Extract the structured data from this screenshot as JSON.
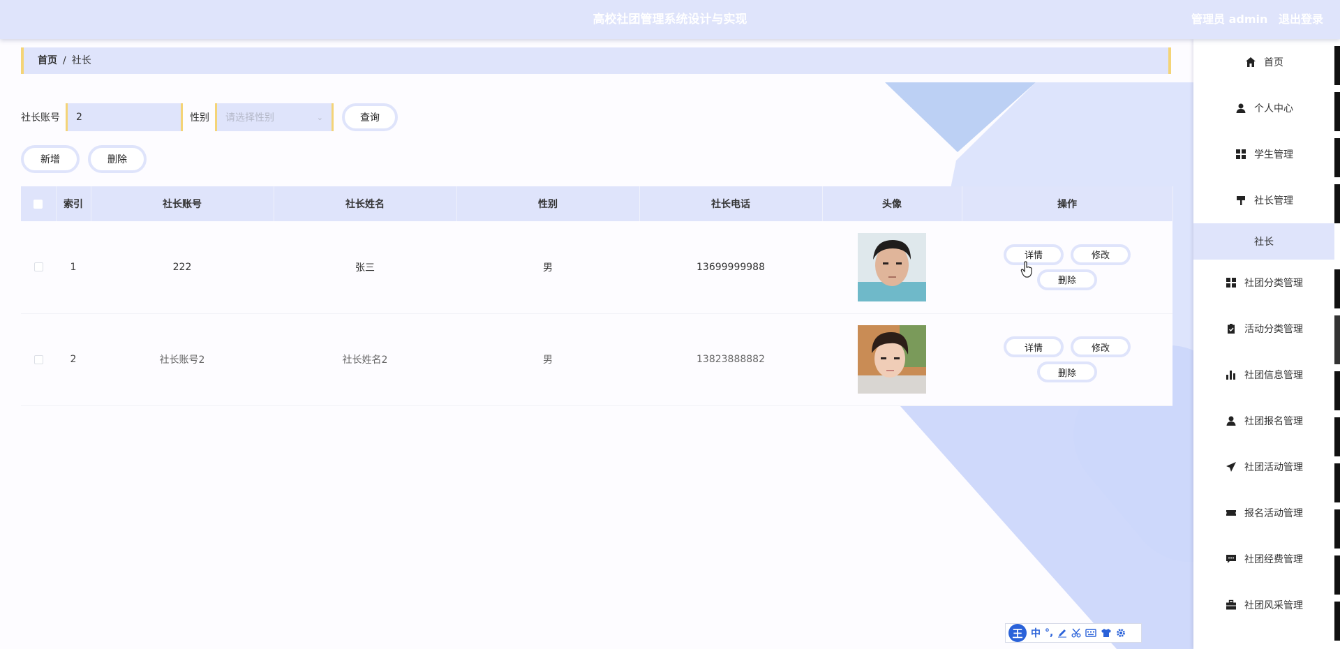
{
  "header": {
    "title": "高校社团管理系统设计与实现",
    "role": "管理员 admin",
    "logout": "退出登录"
  },
  "breadcrumb": {
    "home": "首页",
    "separator": "/",
    "current": "社长"
  },
  "search": {
    "account_label": "社长账号",
    "account_value": "2",
    "gender_label": "性别",
    "gender_placeholder": "请选择性别",
    "query_button": "查询"
  },
  "actions": {
    "add": "新增",
    "delete": "删除"
  },
  "table": {
    "headers": [
      "索引",
      "社长账号",
      "社长姓名",
      "性别",
      "社长电话",
      "头像",
      "操作"
    ],
    "rows": [
      {
        "index": "1",
        "account": "222",
        "name": "张三",
        "gender": "男",
        "phone": "13699999988"
      },
      {
        "index": "2",
        "account": "社长账号2",
        "name": "社长姓名2",
        "gender": "男",
        "phone": "13823888882"
      }
    ],
    "op_detail": "详情",
    "op_edit": "修改",
    "op_delete": "删除"
  },
  "sidebar": {
    "items": [
      {
        "label": "首页",
        "icon": "home-icon"
      },
      {
        "label": "个人中心",
        "icon": "user-icon"
      },
      {
        "label": "学生管理",
        "icon": "grid-icon"
      },
      {
        "label": "社长管理",
        "icon": "signpost-icon"
      },
      {
        "label": "社长",
        "icon": ""
      },
      {
        "label": "社团分类管理",
        "icon": "grid-icon"
      },
      {
        "label": "活动分类管理",
        "icon": "clipboard-icon"
      },
      {
        "label": "社团信息管理",
        "icon": "bar-chart-icon"
      },
      {
        "label": "社团报名管理",
        "icon": "user-icon"
      },
      {
        "label": "社团活动管理",
        "icon": "paper-plane-icon"
      },
      {
        "label": "报名活动管理",
        "icon": "ticket-icon"
      },
      {
        "label": "社团经费管理",
        "icon": "chat-icon"
      },
      {
        "label": "社团风采管理",
        "icon": "briefcase-icon"
      }
    ]
  },
  "ime": {
    "logo": "王",
    "mode": "中",
    "punct": "°,"
  },
  "colors": {
    "accent": "#dfe4fb",
    "border_accent": "#f4d477",
    "ime_blue": "#2a62d9"
  }
}
